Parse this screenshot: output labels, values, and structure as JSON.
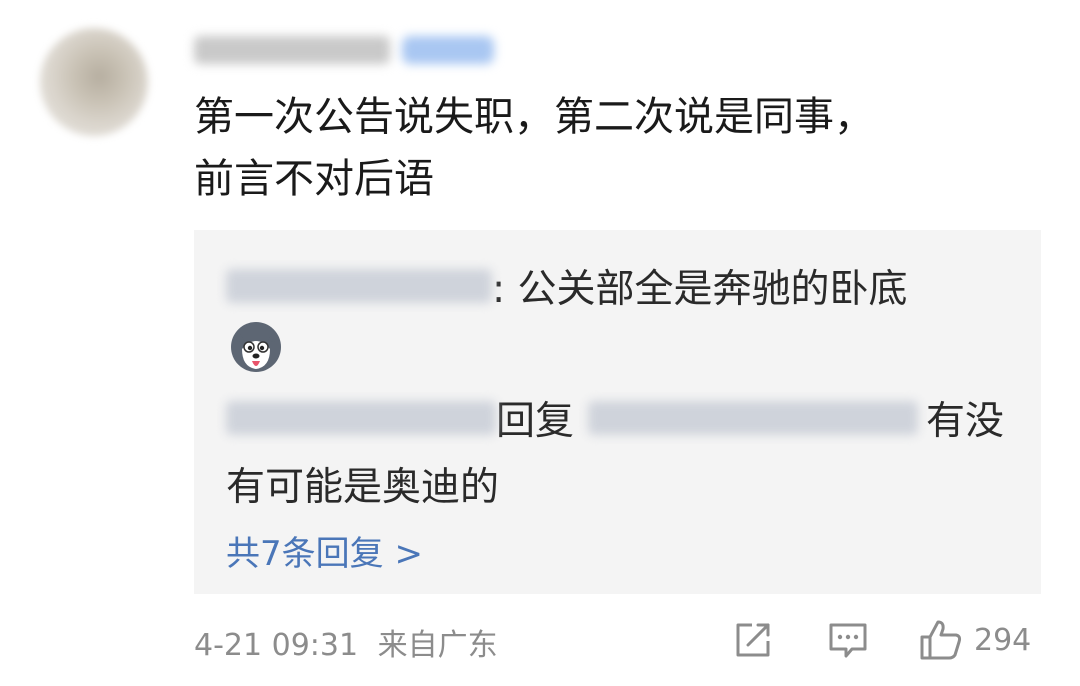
{
  "comment": {
    "text_line1": "第一次公告说失职，第二次说是同事，",
    "text_line2": "前言不对后语"
  },
  "replies": [
    {
      "text": ": 公关部全是奔驰的卧底"
    },
    {
      "reply_word": "回复",
      "text_part1": "有没",
      "text_part2": "有可能是奥迪的"
    }
  ],
  "more_replies_label": "共7条回复 >",
  "footer": {
    "timestamp": "4-21 09:31",
    "location": "来自广东",
    "like_count": "294"
  },
  "icons": {
    "emoji": "husky-emoji-icon",
    "share": "share-icon",
    "comment": "comment-icon",
    "like": "thumbs-up-icon"
  },
  "colors": {
    "link": "#4a76b8",
    "meta": "#8c8c8c",
    "reply_bg": "#f4f4f4"
  }
}
